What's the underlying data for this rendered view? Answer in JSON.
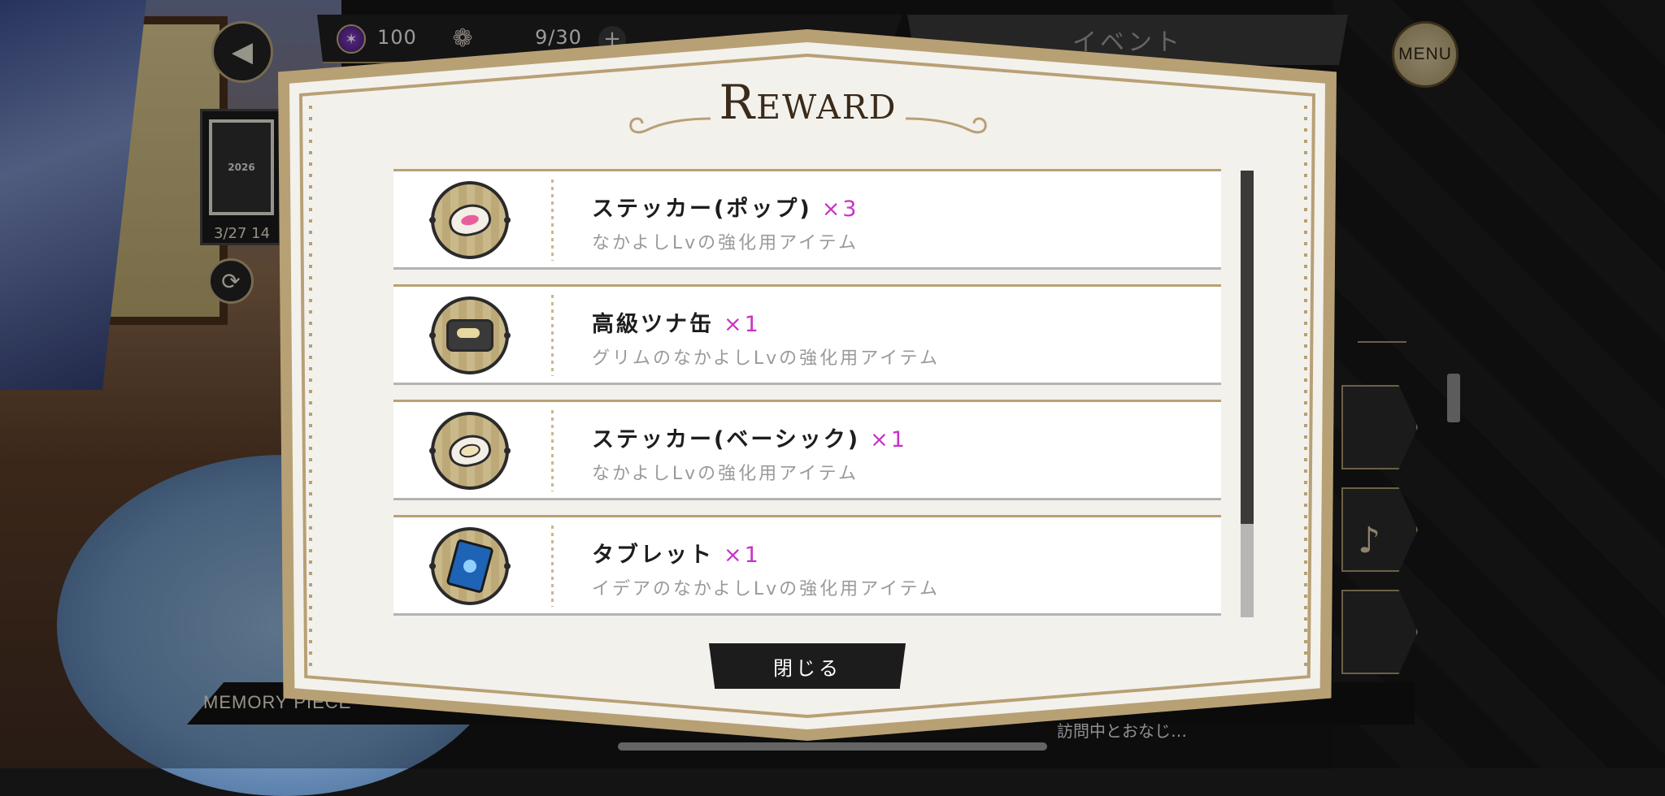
{
  "hud": {
    "gem_count": "100",
    "stamina": "9/30",
    "plus_label": "+",
    "event_tab": "イベント",
    "menu_label": "MENU",
    "thumb_label": "2026",
    "thumb_date": "3/27 14",
    "back_icon": "back-arrow-icon",
    "refresh_icon": "refresh-icon"
  },
  "background": {
    "bottom_text": "MEMORY PIECE",
    "bottom_right_text": "訪問中とおなじ…"
  },
  "modal": {
    "title": "Reward",
    "close_label": "閉じる",
    "accent_color": "#b8a075",
    "quantity_color": "#c832c8",
    "items": [
      {
        "name": "ステッカー(ポップ)",
        "qty": "×3",
        "desc": "なかよしLvの強化用アイテム",
        "icon": "sticker-pop-icon"
      },
      {
        "name": "高級ツナ缶",
        "qty": "×1",
        "desc": "グリムのなかよしLvの強化用アイテム",
        "icon": "tuna-can-icon"
      },
      {
        "name": "ステッカー(ベーシック)",
        "qty": "×1",
        "desc": "なかよしLvの強化用アイテム",
        "icon": "sticker-basic-icon"
      },
      {
        "name": "タブレット",
        "qty": "×1",
        "desc": "イデアのなかよしLvの強化用アイテム",
        "icon": "tablet-icon"
      }
    ],
    "scroll_fraction_visible": 0.79
  }
}
